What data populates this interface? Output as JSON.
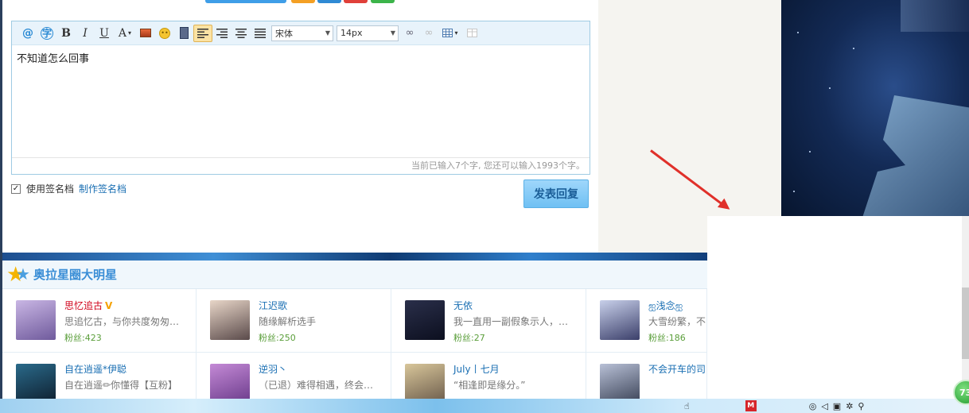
{
  "editor": {
    "font_select": "宋体",
    "size_select": "14px",
    "content": "不知道怎么回事",
    "counter": "当前已输入7个字, 您还可以输入1993个字。"
  },
  "signature": {
    "use_label": "使用签名档",
    "make_link": "制作签名档"
  },
  "submit_label": "发表回复",
  "stars": {
    "title": "奥拉星圈大明星",
    "cards": [
      {
        "name": "思忆追古",
        "vip": "V",
        "bio": "思追忆古，与你共度匆匆…",
        "fans": "粉丝:423",
        "name_color": "red",
        "avatar_colors": [
          "#c9b6e4",
          "#6f5a9c"
        ]
      },
      {
        "name": "江迟歌",
        "bio": "随缘解析选手",
        "fans": "粉丝:250",
        "avatar_colors": [
          "#e8d6c8",
          "#5a4a4a"
        ]
      },
      {
        "name": "无依",
        "bio": "我一直用一副假象示人，…",
        "fans": "粉丝:27",
        "avatar_colors": [
          "#2a2f4a",
          "#0c0f1f"
        ]
      },
      {
        "name": "ஐ浅念ஐ",
        "bio": "大雪纷繁，不",
        "fans": "粉丝:186",
        "avatar_colors": [
          "#c8d0ea",
          "#3b3f6a"
        ]
      },
      {
        "name": "自在逍遥*伊聪",
        "bio": "自在逍遥✏你懂得【互粉】",
        "fans": "",
        "avatar_colors": [
          "#2a6a8a",
          "#0e1e2e"
        ]
      },
      {
        "name": "逆羽丶",
        "bio": "（已退）难得相遇，终会…",
        "fans": "",
        "avatar_colors": [
          "#c48ad6",
          "#6a3a8a"
        ]
      },
      {
        "name": "July丨七月",
        "bio": "“相逢即是缘分。”",
        "fans": "",
        "avatar_colors": [
          "#d8c69a",
          "#6a5a4a"
        ]
      },
      {
        "name": "不会开车的司",
        "bio": "",
        "fans": "",
        "avatar_colors": [
          "#b8c0d6",
          "#3a4256"
        ]
      }
    ]
  },
  "taskbar": {
    "badge": "73"
  },
  "colors": {
    "accent": "#3a8ed6",
    "submit_bg": "#6fc0f3",
    "arrow": "#e0302a",
    "link": "#1a6fb3"
  }
}
